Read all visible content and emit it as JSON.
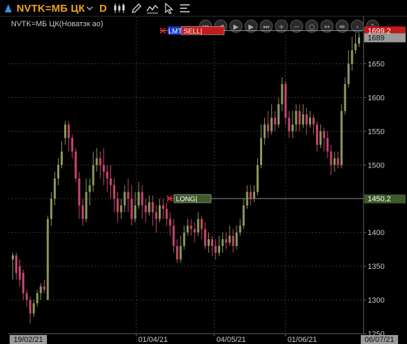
{
  "toolbar": {
    "symbol": "NVTK=МБ ЦК",
    "interval": "D",
    "icons": [
      "triangle-up-icon",
      "chevron-down-icon",
      "candlestick-icon",
      "pencil-icon",
      "chart-settings-icon",
      "cursor-icon",
      "list-icon"
    ]
  },
  "colors": {
    "up": "#8a9a5b",
    "down": "#c8456e",
    "grid": "#3a3a3a",
    "axis_text": "#c8c8c8",
    "order_sell": "#c41a1a",
    "order_long": "#3d5a2a",
    "last_price_bg": "#9a9a9a"
  },
  "chart_data": {
    "type": "candlestick",
    "title": "NVTK=МБ ЦК(Новатэк ао)",
    "ylim": [
      1250,
      1720
    ],
    "y_ticks": [
      "1250",
      "1300",
      "1350",
      "1400",
      "1450",
      "1500",
      "1550",
      "1600",
      "1650"
    ],
    "x_labels": [
      "19/02/21",
      "01/04/21",
      "04/05/21",
      "01/06/21",
      "06/07/21"
    ],
    "grid": true,
    "candles": [
      [
        1360,
        1366,
        1330,
        1370
      ],
      [
        1366,
        1340,
        1330,
        1370
      ],
      [
        1350,
        1330,
        1320,
        1360
      ],
      [
        1340,
        1310,
        1300,
        1345
      ],
      [
        1310,
        1300,
        1290,
        1315
      ],
      [
        1300,
        1280,
        1265,
        1305
      ],
      [
        1280,
        1295,
        1275,
        1300
      ],
      [
        1295,
        1310,
        1290,
        1315
      ],
      [
        1310,
        1320,
        1300,
        1325
      ],
      [
        1320,
        1315,
        1310,
        1330
      ],
      [
        1300,
        1420,
        1300,
        1425
      ],
      [
        1420,
        1450,
        1410,
        1460
      ],
      [
        1450,
        1480,
        1440,
        1490
      ],
      [
        1480,
        1500,
        1470,
        1510
      ],
      [
        1500,
        1520,
        1495,
        1535
      ],
      [
        1540,
        1560,
        1530,
        1565
      ],
      [
        1560,
        1540,
        1520,
        1565
      ],
      [
        1540,
        1520,
        1510,
        1545
      ],
      [
        1520,
        1480,
        1475,
        1525
      ],
      [
        1480,
        1440,
        1420,
        1490
      ],
      [
        1440,
        1420,
        1410,
        1450
      ],
      [
        1420,
        1460,
        1415,
        1480
      ],
      [
        1460,
        1470,
        1440,
        1480
      ],
      [
        1470,
        1500,
        1460,
        1520
      ],
      [
        1500,
        1510,
        1490,
        1525
      ],
      [
        1510,
        1500,
        1480,
        1520
      ],
      [
        1500,
        1490,
        1470,
        1525
      ],
      [
        1490,
        1480,
        1460,
        1500
      ],
      [
        1480,
        1470,
        1450,
        1500
      ],
      [
        1470,
        1450,
        1430,
        1480
      ],
      [
        1450,
        1430,
        1415,
        1460
      ],
      [
        1430,
        1440,
        1420,
        1450
      ],
      [
        1440,
        1460,
        1430,
        1470
      ],
      [
        1460,
        1450,
        1430,
        1480
      ],
      [
        1450,
        1420,
        1410,
        1470
      ],
      [
        1420,
        1440,
        1415,
        1460
      ],
      [
        1440,
        1460,
        1435,
        1475
      ],
      [
        1460,
        1440,
        1420,
        1470
      ],
      [
        1440,
        1430,
        1415,
        1450
      ],
      [
        1430,
        1445,
        1425,
        1455
      ],
      [
        1445,
        1430,
        1410,
        1455
      ],
      [
        1430,
        1420,
        1400,
        1440
      ],
      [
        1420,
        1440,
        1415,
        1450
      ],
      [
        1440,
        1435,
        1420,
        1450
      ],
      [
        1435,
        1420,
        1410,
        1445
      ],
      [
        1420,
        1410,
        1395,
        1430
      ],
      [
        1410,
        1380,
        1370,
        1420
      ],
      [
        1380,
        1360,
        1355,
        1390
      ],
      [
        1360,
        1380,
        1355,
        1395
      ],
      [
        1380,
        1400,
        1375,
        1410
      ],
      [
        1400,
        1410,
        1395,
        1420
      ],
      [
        1410,
        1405,
        1395,
        1420
      ],
      [
        1405,
        1400,
        1385,
        1415
      ],
      [
        1400,
        1420,
        1395,
        1430
      ],
      [
        1420,
        1405,
        1390,
        1425
      ],
      [
        1405,
        1380,
        1375,
        1415
      ],
      [
        1380,
        1390,
        1370,
        1400
      ],
      [
        1390,
        1380,
        1365,
        1395
      ],
      [
        1380,
        1370,
        1360,
        1390
      ],
      [
        1370,
        1380,
        1365,
        1395
      ],
      [
        1380,
        1390,
        1370,
        1400
      ],
      [
        1390,
        1385,
        1375,
        1400
      ],
      [
        1385,
        1395,
        1380,
        1410
      ],
      [
        1395,
        1380,
        1370,
        1405
      ],
      [
        1380,
        1400,
        1375,
        1410
      ],
      [
        1400,
        1410,
        1395,
        1420
      ],
      [
        1410,
        1440,
        1405,
        1450
      ],
      [
        1440,
        1460,
        1435,
        1470
      ],
      [
        1460,
        1450,
        1440,
        1470
      ],
      [
        1450,
        1460,
        1445,
        1470
      ],
      [
        1460,
        1500,
        1455,
        1510
      ],
      [
        1500,
        1540,
        1495,
        1560
      ],
      [
        1540,
        1560,
        1530,
        1570
      ],
      [
        1560,
        1550,
        1540,
        1580
      ],
      [
        1550,
        1570,
        1545,
        1590
      ],
      [
        1570,
        1560,
        1550,
        1580
      ],
      [
        1560,
        1590,
        1555,
        1600
      ],
      [
        1590,
        1620,
        1580,
        1630
      ],
      [
        1620,
        1570,
        1560,
        1625
      ],
      [
        1570,
        1550,
        1540,
        1580
      ],
      [
        1550,
        1560,
        1540,
        1580
      ],
      [
        1560,
        1580,
        1550,
        1590
      ],
      [
        1580,
        1560,
        1550,
        1590
      ],
      [
        1560,
        1575,
        1555,
        1590
      ],
      [
        1575,
        1560,
        1545,
        1585
      ],
      [
        1560,
        1570,
        1555,
        1580
      ],
      [
        1570,
        1560,
        1545,
        1575
      ],
      [
        1560,
        1530,
        1520,
        1565
      ],
      [
        1530,
        1550,
        1525,
        1560
      ],
      [
        1550,
        1540,
        1520,
        1555
      ],
      [
        1540,
        1520,
        1510,
        1550
      ],
      [
        1520,
        1500,
        1485,
        1530
      ],
      [
        1500,
        1510,
        1490,
        1520
      ],
      [
        1510,
        1500,
        1495,
        1520
      ],
      [
        1500,
        1580,
        1495,
        1590
      ],
      [
        1580,
        1620,
        1575,
        1630
      ],
      [
        1620,
        1650,
        1615,
        1670
      ],
      [
        1650,
        1670,
        1640,
        1690
      ],
      [
        1670,
        1680,
        1665,
        1695
      ],
      [
        1680,
        1689,
        1675,
        1695
      ]
    ],
    "last_price": "1689",
    "orders": [
      {
        "type": "LMT",
        "side": "SELL",
        "label": "SELL",
        "price_label": "1699,2",
        "price": 1699.2
      },
      {
        "type": "",
        "side": "LONG",
        "label": "LONG",
        "price_label": "1450,2",
        "price": 1450.2
      }
    ]
  },
  "nav_buttons": [
    "first-icon",
    "prev-icon",
    "play-icon",
    "next-icon",
    "last-icon",
    "zoom-in-icon",
    "zoom-out-icon",
    "zoom-fit-icon",
    "expand-horizontal-icon",
    "compress-horizontal-icon",
    "chevron-right-icon",
    "collapse-up-icon"
  ]
}
